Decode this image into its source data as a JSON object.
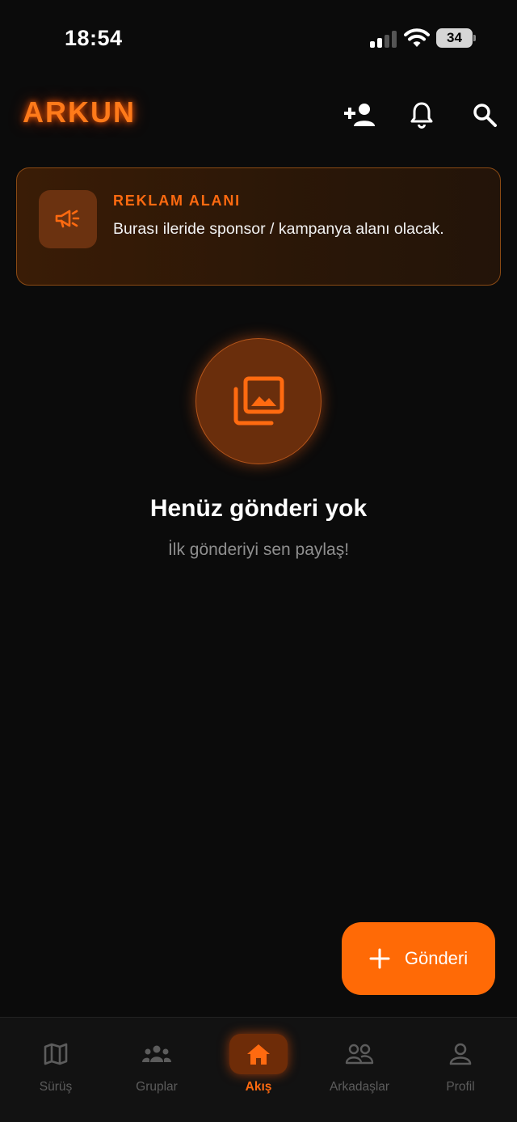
{
  "status_bar": {
    "time": "18:54",
    "battery": "34"
  },
  "header": {
    "logo": "ARKUN",
    "icons": [
      "add-friend-icon",
      "bell-icon",
      "search-icon"
    ]
  },
  "ad": {
    "title": "REKLAM ALANI",
    "text": "Burası ileride sponsor / kampanya alanı olacak.",
    "icon": "megaphone-icon"
  },
  "empty_state": {
    "icon": "photo-library-icon",
    "title": "Henüz gönderi yok",
    "subtitle": "İlk gönderiyi sen paylaş!"
  },
  "fab": {
    "label": "Gönderi",
    "icon": "plus-icon"
  },
  "bottom_nav": {
    "active": "Akış",
    "items": [
      {
        "label": "Sürüş",
        "icon": "map-icon"
      },
      {
        "label": "Gruplar",
        "icon": "groups-icon"
      },
      {
        "label": "Akış",
        "icon": "home-icon"
      },
      {
        "label": "Arkadaşlar",
        "icon": "friends-icon"
      },
      {
        "label": "Profil",
        "icon": "profile-icon"
      }
    ]
  },
  "colors": {
    "accent": "#ff6a06",
    "background": "#0b0b0b",
    "nav_inactive": "#5c5c5c",
    "ad_border": "#8a4a14"
  }
}
